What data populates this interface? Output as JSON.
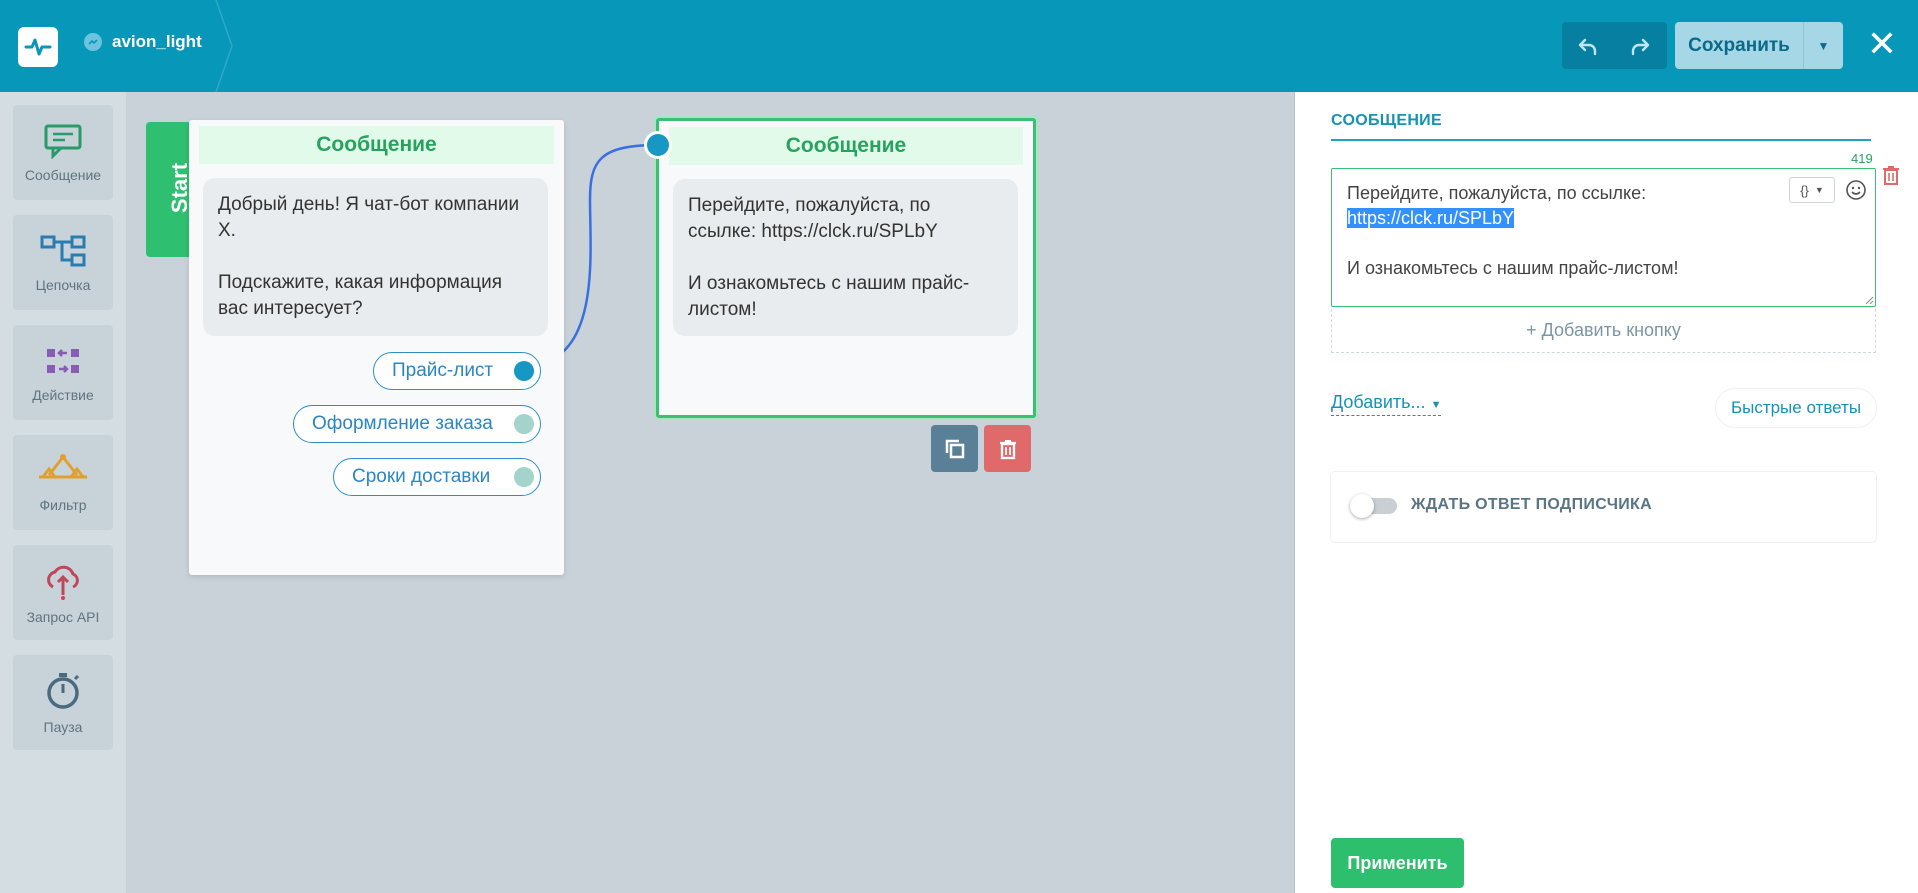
{
  "header": {
    "bot_name": "avion_light",
    "save_label": "Сохранить"
  },
  "toolbar": {
    "items": [
      {
        "label": "Сообщение",
        "icon": "message-icon"
      },
      {
        "label": "Цепочка",
        "icon": "chain-icon"
      },
      {
        "label": "Действие",
        "icon": "action-icon"
      },
      {
        "label": "Фильтр",
        "icon": "filter-icon"
      },
      {
        "label": "Запрос API",
        "icon": "api-request-icon"
      },
      {
        "label": "Пауза",
        "icon": "pause-timer-icon"
      }
    ]
  },
  "canvas": {
    "start_label": "Start",
    "node1": {
      "title": "Сообщение",
      "text": "Добрый день! Я чат-бот компании X.\n\nПодскажите, какая информация вас интересует?",
      "buttons": [
        "Прайс-лист",
        "Оформление заказа",
        "Сроки доставки"
      ]
    },
    "node2": {
      "title": "Сообщение",
      "text": "Перейдите, пожалуйста, по ссылке: https://clck.ru/SPLbY\n\nИ ознакомьтесь с нашим прайс-листом!"
    }
  },
  "panel": {
    "title": "СООБЩЕНИЕ",
    "char_counter": "419",
    "editor_lines": [
      "Перейдите, пожалуйста, по ссылке:",
      "https://clck.ru/SPLbY",
      "",
      "И ознакомьтесь с нашим прайс-листом!"
    ],
    "variable_btn": "{}",
    "add_button_label": "+ Добавить кнопку",
    "add_dropdown_label": "Добавить...",
    "quick_replies_label": "Быстрые ответы",
    "wait_label": "ЖДАТЬ ОТВЕТ ПОДПИСЧИКА",
    "wait_enabled": false,
    "apply_label": "Применить"
  },
  "colors": {
    "header": "#0797b9",
    "accent_green": "#2dbf6e",
    "delete_red": "#e06a6a"
  }
}
